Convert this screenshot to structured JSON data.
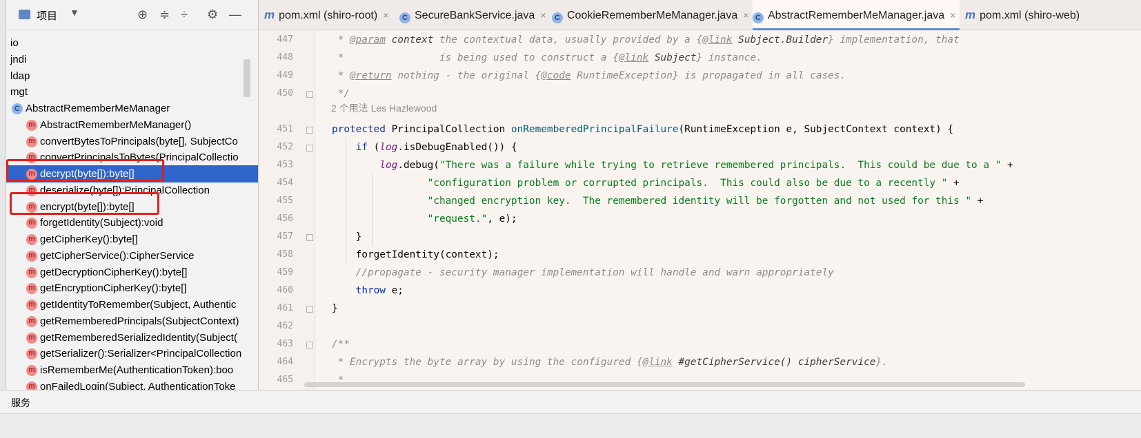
{
  "project_panel": {
    "title": "项目",
    "tools": [
      "crosshair-icon",
      "expand-all-icon",
      "collapse-all-icon",
      "gear-icon",
      "minimize-icon"
    ],
    "tree_items": [
      {
        "label": "io",
        "kind": "package",
        "selected": false
      },
      {
        "label": "jndi",
        "kind": "package",
        "selected": false
      },
      {
        "label": "ldap",
        "kind": "package",
        "selected": false
      },
      {
        "label": "mgt",
        "kind": "package",
        "selected": false
      },
      {
        "label": "AbstractRememberMeManager",
        "kind": "class",
        "selected": false
      },
      {
        "label": "AbstractRememberMeManager()",
        "kind": "method",
        "selected": false
      },
      {
        "label": "convertBytesToPrincipals(byte[], SubjectCo",
        "kind": "method",
        "selected": false
      },
      {
        "label": "convertPrincipalsToBytes(PrincipalCollectio",
        "kind": "method",
        "selected": false
      },
      {
        "label": "decrypt(byte[]):byte[]",
        "kind": "method",
        "selected": true
      },
      {
        "label": "deserialize(byte[]):PrincipalCollection",
        "kind": "method",
        "selected": false
      },
      {
        "label": "encrypt(byte[]):byte[]",
        "kind": "method",
        "selected": false
      },
      {
        "label": "forgetIdentity(Subject):void",
        "kind": "method",
        "selected": false
      },
      {
        "label": "getCipherKey():byte[]",
        "kind": "method",
        "selected": false
      },
      {
        "label": "getCipherService():CipherService",
        "kind": "method",
        "selected": false
      },
      {
        "label": "getDecryptionCipherKey():byte[]",
        "kind": "method",
        "selected": false
      },
      {
        "label": "getEncryptionCipherKey():byte[]",
        "kind": "method",
        "selected": false
      },
      {
        "label": "getIdentityToRemember(Subject, Authentic",
        "kind": "method",
        "selected": false
      },
      {
        "label": "getRememberedPrincipals(SubjectContext)",
        "kind": "method",
        "selected": false
      },
      {
        "label": "getRememberedSerializedIdentity(Subject(",
        "kind": "method",
        "selected": false
      },
      {
        "label": "getSerializer():Serializer<PrincipalCollection",
        "kind": "method",
        "selected": false
      },
      {
        "label": "isRememberMe(AuthenticationToken):boo",
        "kind": "method",
        "selected": false
      },
      {
        "label": "onFailedLogin(Subject, AuthenticationToke",
        "kind": "method",
        "selected": false
      }
    ]
  },
  "tabs": [
    {
      "label": "pom.xml (shiro-root)",
      "icon": "maven-icon",
      "closable": true,
      "active": false
    },
    {
      "label": "SecureBankService.java",
      "icon": "class-icon",
      "closable": true,
      "active": false
    },
    {
      "label": "CookieRememberMeManager.java",
      "icon": "class-icon",
      "closable": true,
      "active": false
    },
    {
      "label": "AbstractRememberMeManager.java",
      "icon": "class-icon",
      "closable": true,
      "active": true
    },
    {
      "label": "pom.xml (shiro-web)",
      "icon": "maven-icon",
      "closable": false,
      "active": false
    }
  ],
  "editor": {
    "line_numbers": [
      "447",
      "448",
      "449",
      "450",
      "451",
      "452",
      "453",
      "454",
      "455",
      "456",
      "457",
      "458",
      "459",
      "460",
      "461",
      "462",
      "463",
      "464",
      "465"
    ],
    "inlay_hint": "2 个用法   Les Hazlewood",
    "code_lines": [
      [
        [
          "cm",
          " * "
        ],
        [
          "cm-tag",
          "@param"
        ],
        [
          "cm-ref",
          " context"
        ],
        [
          "cm",
          " the contextual data, usually provided by a {"
        ],
        [
          "cm-tag",
          "@link"
        ],
        [
          "cm-ref",
          " Subject.Builder"
        ],
        [
          "cm",
          "} implementation, that"
        ]
      ],
      [
        [
          "cm",
          " *                is being used to construct a {"
        ],
        [
          "cm-tag",
          "@link"
        ],
        [
          "cm-ref",
          " Subject"
        ],
        [
          "cm",
          "} instance."
        ]
      ],
      [
        [
          "cm",
          " * "
        ],
        [
          "cm-tag",
          "@return"
        ],
        [
          "cm",
          " nothing - the original {"
        ],
        [
          "cm-tag",
          "@code"
        ],
        [
          "cm",
          " RuntimeException} is propagated in all cases."
        ]
      ],
      [
        [
          "cm",
          " */"
        ]
      ],
      [
        [
          "kw",
          "protected "
        ],
        [
          "pl",
          "PrincipalCollection "
        ],
        [
          "fn",
          "onRememberedPrincipalFailure"
        ],
        [
          "pl",
          "(RuntimeException e, SubjectContext context) {"
        ]
      ],
      [
        [
          "pl",
          "    "
        ],
        [
          "kw",
          "if "
        ],
        [
          "pl",
          "("
        ],
        [
          "fld",
          "log"
        ],
        [
          "pl",
          ".isDebugEnabled()) {"
        ]
      ],
      [
        [
          "pl",
          "        "
        ],
        [
          "fld",
          "log"
        ],
        [
          "pl",
          ".debug("
        ],
        [
          "str",
          "\"There was a failure while trying to retrieve remembered principals.  This could be due to a \""
        ],
        [
          "pl",
          " +"
        ]
      ],
      [
        [
          "pl",
          "                "
        ],
        [
          "str",
          "\"configuration problem or corrupted principals.  This could also be due to a recently \""
        ],
        [
          "pl",
          " +"
        ]
      ],
      [
        [
          "pl",
          "                "
        ],
        [
          "str",
          "\"changed encryption key.  The remembered identity will be forgotten and not used for this \""
        ],
        [
          "pl",
          " +"
        ]
      ],
      [
        [
          "pl",
          "                "
        ],
        [
          "str",
          "\"request.\""
        ],
        [
          "pl",
          ", e);"
        ]
      ],
      [
        [
          "pl",
          "    }"
        ]
      ],
      [
        [
          "pl",
          "    forgetIdentity(context);"
        ]
      ],
      [
        [
          "pl",
          "    "
        ],
        [
          "cm",
          "//propagate - security manager implementation will handle and warn appropriately"
        ]
      ],
      [
        [
          "pl",
          "    "
        ],
        [
          "kw",
          "throw "
        ],
        [
          "pl",
          "e;"
        ]
      ],
      [
        [
          "pl",
          "}"
        ]
      ],
      [
        [
          "pl",
          ""
        ]
      ],
      [
        [
          "cm",
          "/**"
        ]
      ],
      [
        [
          "cm",
          " * Encrypts the byte array by using the configured {"
        ],
        [
          "cm-tag",
          "@link"
        ],
        [
          "cm-ref",
          " #getCipherService() cipherService"
        ],
        [
          "cm",
          "}."
        ]
      ],
      [
        [
          "cm",
          " *"
        ]
      ]
    ]
  },
  "bottom_bar": {
    "services_label": "服务"
  },
  "colors": {
    "selection": "#2f65ca",
    "highlight_box": "#e0201c",
    "keyword": "#0033b3",
    "string": "#067d17",
    "comment": "#8c8c8c"
  }
}
